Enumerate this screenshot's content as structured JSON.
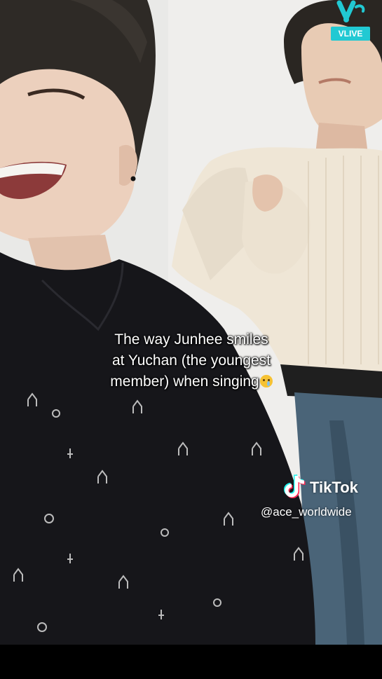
{
  "caption": {
    "line1": "The way Junhee smiles",
    "line2": "at Yuchan (the youngest",
    "line3": "member) when singing"
  },
  "watermark": {
    "brand": "TikTok",
    "handle": "@ace_worldwide"
  },
  "stream_badge": {
    "label": "VLIVE"
  },
  "colors": {
    "vlive_accent": "#21c9d3",
    "tiktok_cyan": "#25f4ee",
    "tiktok_red": "#fe2c55",
    "caption_text": "#ffffff"
  },
  "icons": [
    "vlive-logo-icon",
    "tiktok-note-icon",
    "crying-face-emoji-icon"
  ]
}
